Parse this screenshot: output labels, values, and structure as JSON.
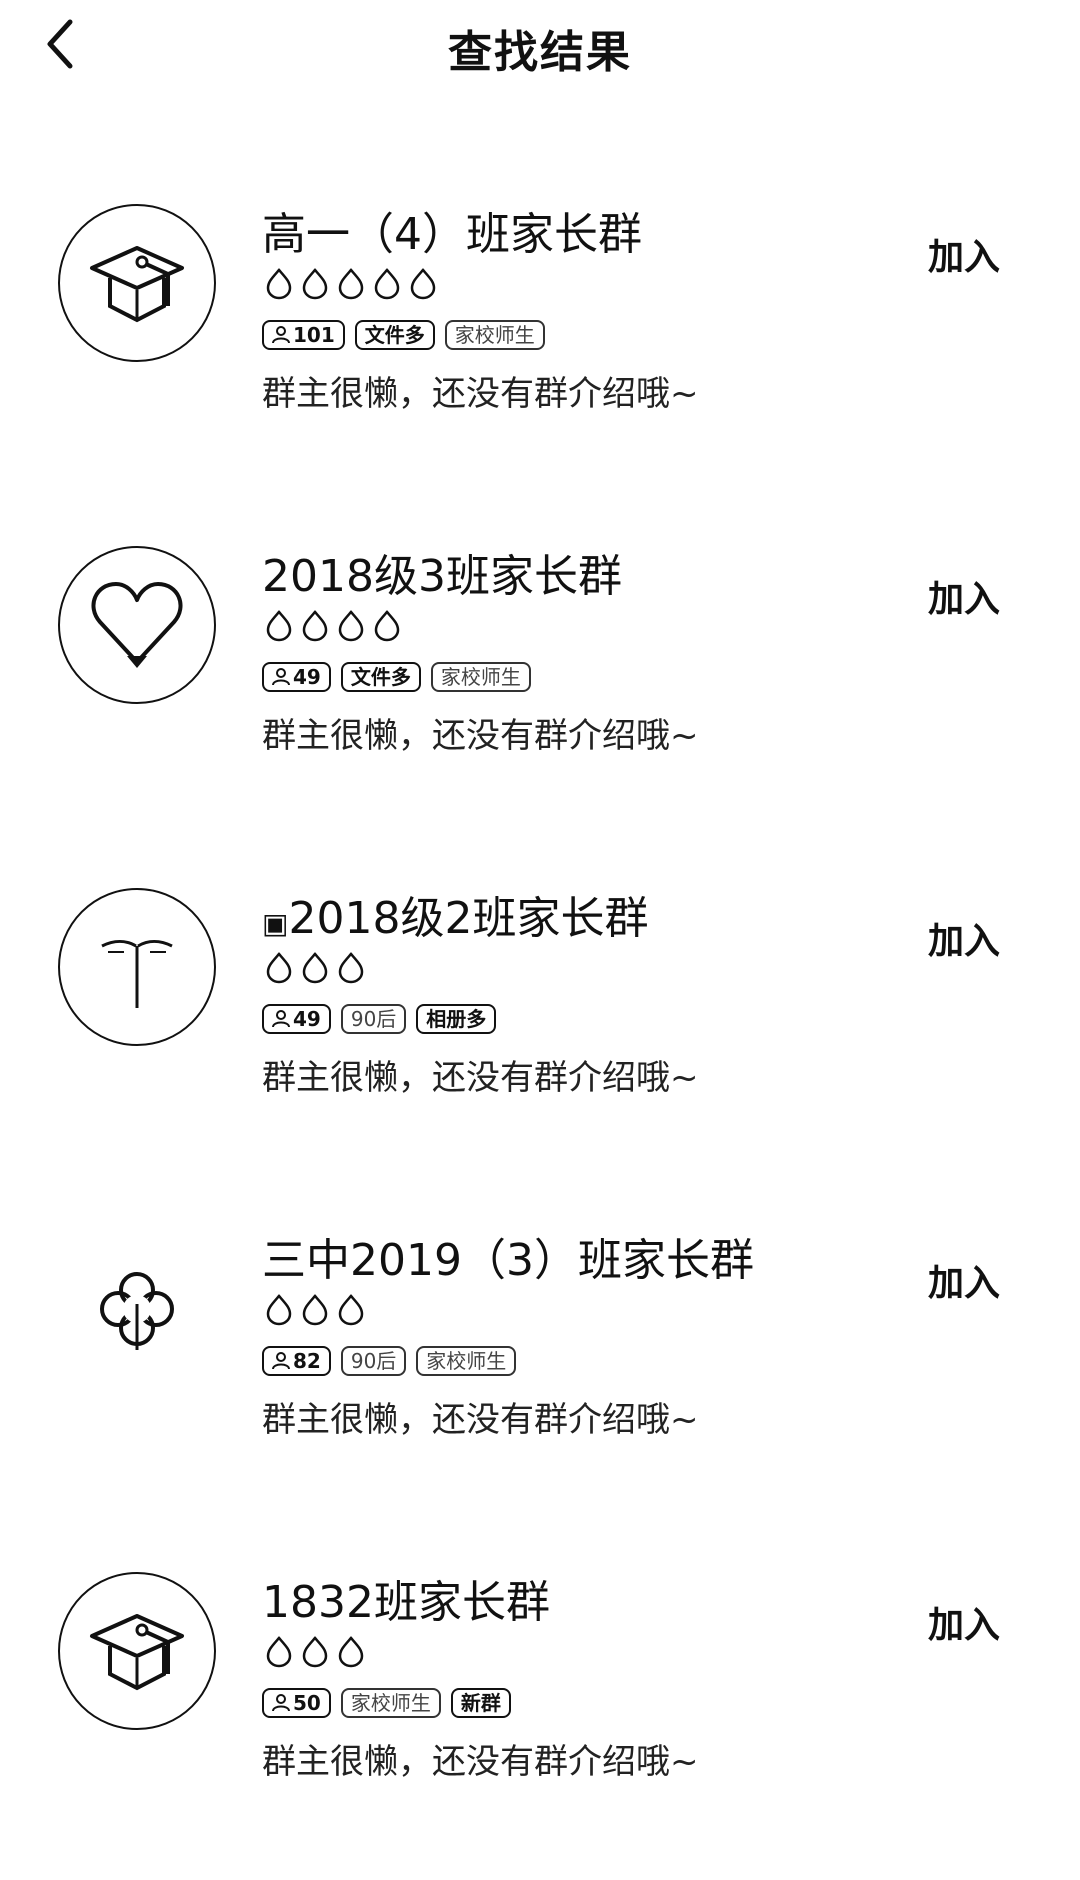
{
  "header": {
    "title": "查找结果",
    "back_icon": "chevron-left-icon"
  },
  "groups": [
    {
      "name": "高一（4）班家长群",
      "avatar_icon": "graduation-cap-icon",
      "flames": 5,
      "tags": [
        "101",
        "文件多",
        "家校师生"
      ],
      "intro": "群主很懒，还没有群介绍哦~",
      "join_label": "加入"
    },
    {
      "name": "2018级3班家长群",
      "avatar_icon": "heart-icon",
      "flames": 4,
      "tags": [
        "49",
        "文件多",
        "家校师生"
      ],
      "intro": "群主很懒，还没有群介绍哦~",
      "join_label": "加入"
    },
    {
      "name": "2018级2班家长群",
      "avatar_icon": "lamp-icon",
      "flames": 3,
      "tags": [
        "49",
        "90后",
        "相册多"
      ],
      "intro": "群主很懒，还没有群介绍哦~",
      "join_label": "加入"
    },
    {
      "name": "三中2019（3）班家长群",
      "avatar_icon": "clover-icon",
      "flames": 3,
      "tags": [
        "82",
        "90后",
        "家校师生"
      ],
      "intro": "群主很懒，还没有群介绍哦~",
      "join_label": "加入"
    },
    {
      "name": "1832班家长群",
      "avatar_icon": "graduation-cap-icon",
      "flames": 3,
      "tags": [
        "50",
        "家校师生",
        "新群"
      ],
      "intro": "群主很懒，还没有群介绍哦~",
      "join_label": "加入"
    }
  ]
}
